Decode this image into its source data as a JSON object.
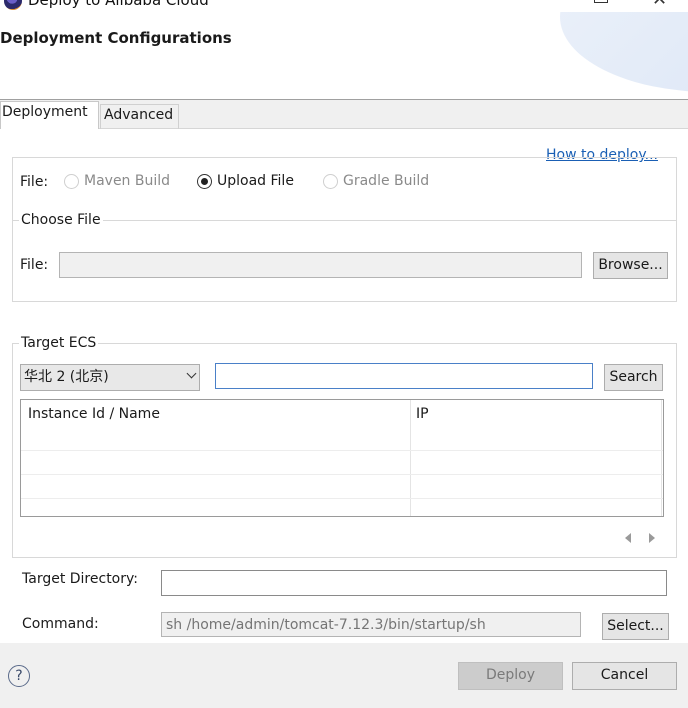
{
  "window": {
    "title": "Deploy to Alibaba Cloud",
    "minimize_icon": "minimize-icon",
    "close_glyph": "✕"
  },
  "header": {
    "title": "Deployment Configurations"
  },
  "tabs": [
    {
      "label": "Deployment",
      "active": true
    },
    {
      "label": "Advanced",
      "active": false
    }
  ],
  "deployment": {
    "how_to_link": "How to deploy...",
    "file_label": "File:",
    "file_options": [
      {
        "label": "Maven Build",
        "selected": false,
        "enabled": false
      },
      {
        "label": "Upload File",
        "selected": true,
        "enabled": true
      },
      {
        "label": "Gradle Build",
        "selected": false,
        "enabled": false
      }
    ],
    "choose_file": {
      "legend": "Choose File",
      "file_label": "File:",
      "file_value": "",
      "browse_label": "Browse..."
    },
    "target_ecs": {
      "legend": "Target ECS",
      "region_selected": "华北 2 (北京)",
      "search_value": "",
      "search_label": "Search",
      "columns": [
        "Instance Id / Name",
        "IP"
      ],
      "rows": []
    },
    "target_directory": {
      "label": "Target Directory:",
      "value": ""
    },
    "command": {
      "label": "Command:",
      "placeholder": "sh /home/admin/tomcat-7.12.3/bin/startup/sh",
      "select_label": "Select..."
    }
  },
  "footer": {
    "help_glyph": "?",
    "deploy_label": "Deploy",
    "cancel_label": "Cancel"
  }
}
